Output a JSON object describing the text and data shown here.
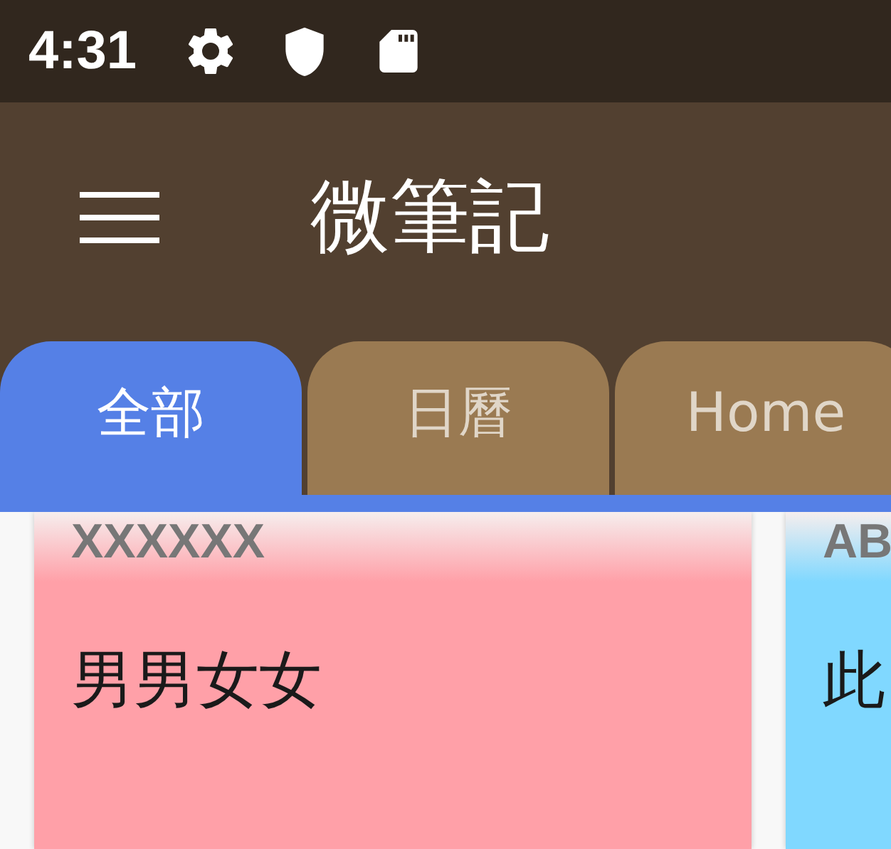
{
  "status_bar": {
    "time": "4:31"
  },
  "app_bar": {
    "title": "微筆記"
  },
  "tabs": [
    {
      "label": "全部",
      "selected": true
    },
    {
      "label": "日曆",
      "selected": false
    },
    {
      "label": "Home",
      "selected": false
    }
  ],
  "notes": [
    {
      "title": "XXXXXX",
      "body": "男男女女",
      "color": "#ffa0a8"
    },
    {
      "title": "AB",
      "body": "此",
      "color": "#80d8ff"
    }
  ]
}
